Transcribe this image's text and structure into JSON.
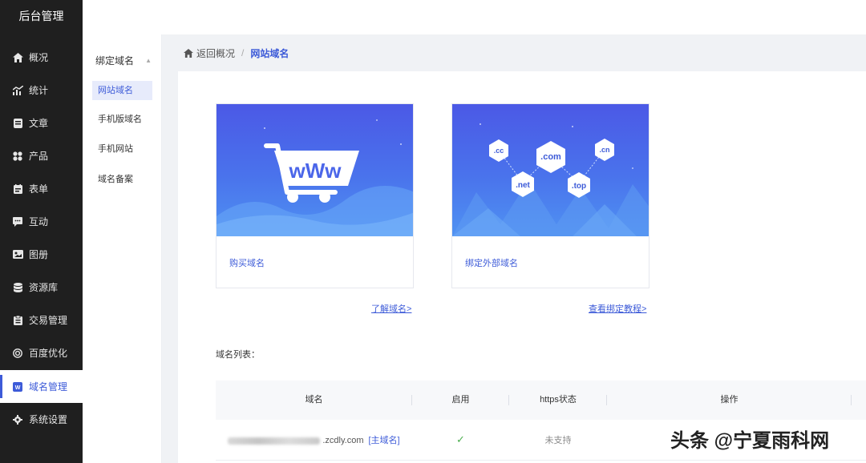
{
  "sidebar": {
    "title": "后台管理",
    "items": [
      {
        "label": "概况",
        "icon": "home-icon",
        "active": false
      },
      {
        "label": "统计",
        "icon": "chart-icon",
        "active": false
      },
      {
        "label": "文章",
        "icon": "article-icon",
        "active": false
      },
      {
        "label": "产品",
        "icon": "grid-icon",
        "active": false
      },
      {
        "label": "表单",
        "icon": "form-icon",
        "active": false
      },
      {
        "label": "互动",
        "icon": "chat-icon",
        "active": false
      },
      {
        "label": "图册",
        "icon": "image-icon",
        "active": false
      },
      {
        "label": "资源库",
        "icon": "database-icon",
        "active": false
      },
      {
        "label": "交易管理",
        "icon": "clipboard-icon",
        "active": false
      },
      {
        "label": "百度优化",
        "icon": "target-icon",
        "active": false
      },
      {
        "label": "域名管理",
        "icon": "web-icon",
        "active": true
      },
      {
        "label": "系统设置",
        "icon": "gear-icon",
        "active": false
      }
    ]
  },
  "submenu": {
    "group": "绑定域名",
    "items": [
      {
        "label": "网站域名",
        "active": true
      },
      {
        "label": "手机版域名",
        "active": false
      },
      {
        "label": "手机网站",
        "active": false
      },
      {
        "label": "域名备案",
        "active": false
      }
    ]
  },
  "breadcrumb": {
    "back": "返回概况",
    "separator": "/",
    "current": "网站域名"
  },
  "cards": {
    "buy": {
      "label": "购买域名",
      "badge": "wWw"
    },
    "bind": {
      "label": "绑定外部域名",
      "tags": [
        ".cc",
        ".com",
        ".cn",
        ".net",
        ".top"
      ]
    }
  },
  "links": {
    "learn": "了解域名>",
    "tutorial": "查看绑定教程>"
  },
  "table": {
    "title": "域名列表：",
    "headers": [
      "域名",
      "启用",
      "https状态",
      "操作"
    ],
    "rows": [
      {
        "domain": ".zcdly.com",
        "primary": "[主域名]",
        "enabled": "✓",
        "https": "未支持"
      }
    ]
  },
  "watermark": "头条 @宁夏雨科网",
  "colors": {
    "accent": "#3d5bd8",
    "sidebar_bg": "#1f1f1f",
    "success": "#4caf50"
  }
}
